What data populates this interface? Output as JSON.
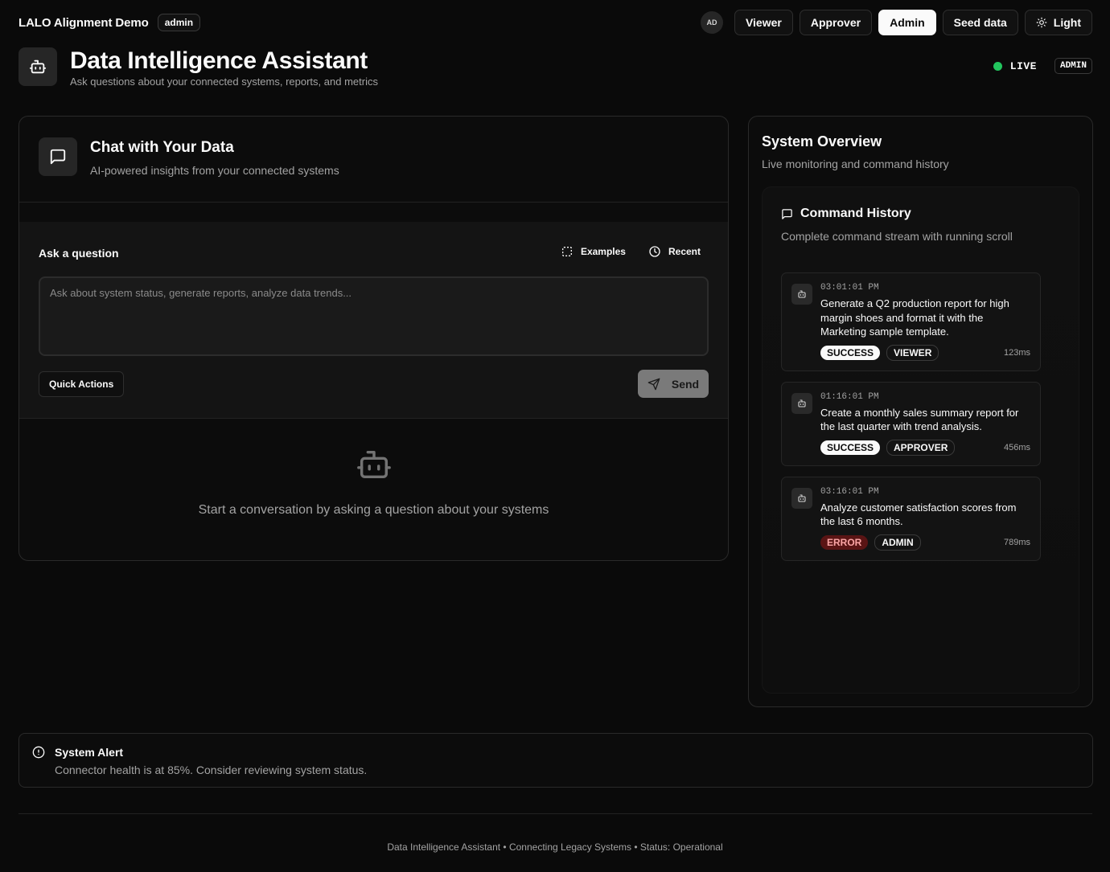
{
  "topbar": {
    "brand": "LALO Alignment Demo",
    "role_pill": "admin",
    "avatar": "AD",
    "buttons": [
      {
        "label": "Viewer",
        "active": false
      },
      {
        "label": "Approver",
        "active": false
      },
      {
        "label": "Admin",
        "active": true
      },
      {
        "label": "Seed data",
        "active": false
      }
    ],
    "theme_label": "Light",
    "theme_icon": "sun-icon"
  },
  "header": {
    "icon": "bot-icon",
    "title": "Data Intelligence Assistant",
    "subtitle": "Ask questions about your connected systems, reports, and metrics",
    "live_label": "LIVE",
    "role_badge": "ADMIN",
    "live_color": "#22c55e"
  },
  "chat": {
    "icon": "message-square-icon",
    "title": "Chat with Your Data",
    "subtitle": "AI-powered insights from your connected systems",
    "ask_label": "Ask a question",
    "examples_label": "Examples",
    "recent_label": "Recent",
    "input_placeholder": "Ask about system status, generate reports, analyze data trends...",
    "input_value": "",
    "quick_actions_label": "Quick Actions",
    "send_label": "Send",
    "empty_text": "Start a conversation by asking a question about your systems"
  },
  "system": {
    "title": "System Overview",
    "subtitle": "Live monitoring and command history",
    "history_title": "Command History",
    "history_subtitle": "Complete command stream with running scroll",
    "items": [
      {
        "time": "03:01:01 PM",
        "text": "Generate a Q2 production report for high margin shoes and format it with the Marketing sample template.",
        "status": "SUCCESS",
        "role": "VIEWER",
        "duration": "123ms"
      },
      {
        "time": "01:16:01 PM",
        "text": "Create a monthly sales summary report for the last quarter with trend analysis.",
        "status": "SUCCESS",
        "role": "APPROVER",
        "duration": "456ms"
      },
      {
        "time": "03:16:01 PM",
        "text": "Analyze customer satisfaction scores from the last 6 months.",
        "status": "ERROR",
        "role": "ADMIN",
        "duration": "789ms"
      }
    ]
  },
  "alert": {
    "title": "System Alert",
    "text": "Connector health is at 85%. Consider reviewing system status."
  },
  "footer": {
    "text": "Data Intelligence Assistant • Connecting Legacy Systems • Status: Operational"
  }
}
